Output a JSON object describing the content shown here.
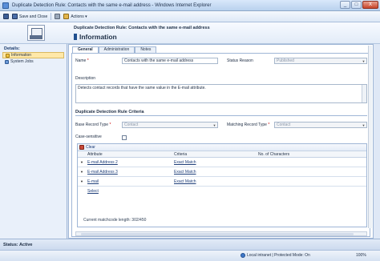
{
  "window": {
    "title": "Duplicate Detection Rule: Contacts with the same e-mail address - Windows Internet Explorer",
    "min": "_",
    "max": "□",
    "close": "X"
  },
  "toolbar": {
    "save_and_close": "Save and Close",
    "actions": "Actions ▾"
  },
  "header": {
    "subtitle": "Duplicate Detection Rule: Contacts with the same e-mail address",
    "title": "Information"
  },
  "leftnav": {
    "heading": "Details:",
    "items": [
      "Information",
      "System Jobs"
    ]
  },
  "tabs": [
    "General",
    "Administration",
    "Notes"
  ],
  "form": {
    "name_label": "Name",
    "name_value": "Contacts with the same e-mail address",
    "status_label": "Status Reason",
    "status_value": "Published",
    "description_label": "Description",
    "description_value": "Detects contact records that have the same value in the E-mail attribute.",
    "section_title": "Duplicate Detection Rule Criteria",
    "base_label": "Base Record Type",
    "base_value": "Contact",
    "matching_label": "Matching Record Type",
    "matching_value": "Contact",
    "case_label": "Case-sensitive",
    "required_marker": "*"
  },
  "grid": {
    "clear_label": "Clear",
    "columns": [
      "Attribute",
      "Criteria",
      "No. of Characters"
    ],
    "rows": [
      {
        "attribute": "E-mail Address 2",
        "criteria": "Exact Match",
        "chars": ""
      },
      {
        "attribute": "E-mail Address 3",
        "criteria": "Exact Match",
        "chars": ""
      },
      {
        "attribute": "E-mail",
        "criteria": "Exact Match",
        "chars": ""
      }
    ],
    "select_label": "Select",
    "matchcode": "Current matchcode length: 302/450"
  },
  "status": {
    "text": "Status: Active"
  },
  "iebar": {
    "zone": "Local intranet | Protected Mode: On",
    "zoom": "100%"
  }
}
